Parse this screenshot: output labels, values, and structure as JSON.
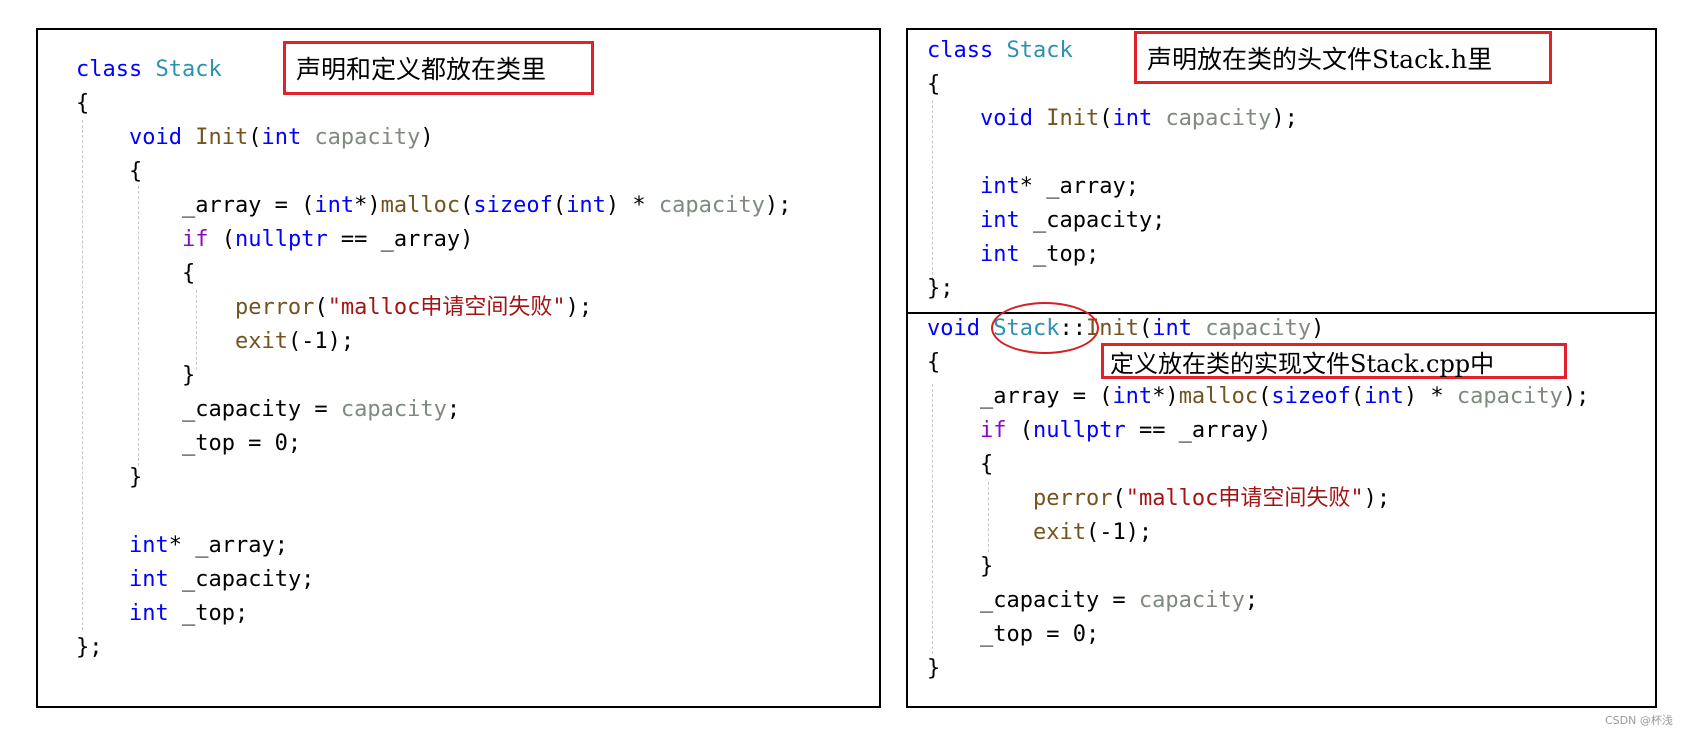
{
  "left_panel": {
    "note": "声明和定义都放在类里",
    "code": [
      [
        [
          "class ",
          "kw"
        ],
        [
          "Stack",
          "ty"
        ]
      ],
      [
        [
          "{",
          "pl"
        ]
      ],
      [
        [
          "    ",
          "pl"
        ],
        [
          "void ",
          "kw"
        ],
        [
          "Init",
          "fn"
        ],
        [
          "(",
          "pl"
        ],
        [
          "int ",
          "kw"
        ],
        [
          "capacity",
          "pm"
        ],
        [
          ")",
          "pl"
        ]
      ],
      [
        [
          "    {",
          "pl"
        ]
      ],
      [
        [
          "        _array = (",
          "pl"
        ],
        [
          "int",
          "kw"
        ],
        [
          "*)",
          "pl"
        ],
        [
          "malloc",
          "fn"
        ],
        [
          "(",
          "pl"
        ],
        [
          "sizeof",
          "kw"
        ],
        [
          "(",
          "pl"
        ],
        [
          "int",
          "kw"
        ],
        [
          ") * ",
          "pl"
        ],
        [
          "capacity",
          "pm"
        ],
        [
          ");",
          "pl"
        ]
      ],
      [
        [
          "        ",
          "pl"
        ],
        [
          "if",
          "ct"
        ],
        [
          " (",
          "pl"
        ],
        [
          "nullptr",
          "kw"
        ],
        [
          " == _array)",
          "pl"
        ]
      ],
      [
        [
          "        {",
          "pl"
        ]
      ],
      [
        [
          "            ",
          "pl"
        ],
        [
          "perror",
          "fn"
        ],
        [
          "(",
          "pl"
        ],
        [
          "\"malloc申请空间失败\"",
          "st"
        ],
        [
          ");",
          "pl"
        ]
      ],
      [
        [
          "            ",
          "pl"
        ],
        [
          "exit",
          "fn"
        ],
        [
          "(-1);",
          "pl"
        ]
      ],
      [
        [
          "        }",
          "pl"
        ]
      ],
      [
        [
          "        _capacity = ",
          "pl"
        ],
        [
          "capacity",
          "pm"
        ],
        [
          ";",
          "pl"
        ]
      ],
      [
        [
          "        _top = 0;",
          "pl"
        ]
      ],
      [
        [
          "    }",
          "pl"
        ]
      ],
      [
        [
          "",
          "pl"
        ]
      ],
      [
        [
          "    ",
          "pl"
        ],
        [
          "int",
          "kw"
        ],
        [
          "* _array;",
          "pl"
        ]
      ],
      [
        [
          "    ",
          "pl"
        ],
        [
          "int",
          "kw"
        ],
        [
          " _capacity;",
          "pl"
        ]
      ],
      [
        [
          "    ",
          "pl"
        ],
        [
          "int",
          "kw"
        ],
        [
          " _top;",
          "pl"
        ]
      ],
      [
        [
          "};",
          "pl"
        ]
      ]
    ]
  },
  "right_top_panel": {
    "note": "声明放在类的头文件Stack.h里",
    "code": [
      [
        [
          "class ",
          "kw"
        ],
        [
          "Stack",
          "ty"
        ]
      ],
      [
        [
          "{",
          "pl"
        ]
      ],
      [
        [
          "    ",
          "pl"
        ],
        [
          "void ",
          "kw"
        ],
        [
          "Init",
          "fn"
        ],
        [
          "(",
          "pl"
        ],
        [
          "int ",
          "kw"
        ],
        [
          "capacity",
          "pm"
        ],
        [
          ");",
          "pl"
        ]
      ],
      [
        [
          "",
          "pl"
        ]
      ],
      [
        [
          "    ",
          "pl"
        ],
        [
          "int",
          "kw"
        ],
        [
          "* _array;",
          "pl"
        ]
      ],
      [
        [
          "    ",
          "pl"
        ],
        [
          "int",
          "kw"
        ],
        [
          " _capacity;",
          "pl"
        ]
      ],
      [
        [
          "    ",
          "pl"
        ],
        [
          "int",
          "kw"
        ],
        [
          " _top;",
          "pl"
        ]
      ],
      [
        [
          "};",
          "pl"
        ]
      ]
    ]
  },
  "right_bottom_panel": {
    "note": "定义放在类的实现文件Stack.cpp中",
    "code": [
      [
        [
          "void ",
          "kw"
        ],
        [
          "Stack",
          "ty"
        ],
        [
          "::",
          "pl"
        ],
        [
          "Init",
          "fn"
        ],
        [
          "(",
          "pl"
        ],
        [
          "int ",
          "kw"
        ],
        [
          "capacity",
          "pm"
        ],
        [
          ")",
          "pl"
        ]
      ],
      [
        [
          "{",
          "pl"
        ]
      ],
      [
        [
          "    _array = (",
          "pl"
        ],
        [
          "int",
          "kw"
        ],
        [
          "*)",
          "pl"
        ],
        [
          "malloc",
          "fn"
        ],
        [
          "(",
          "pl"
        ],
        [
          "sizeof",
          "kw"
        ],
        [
          "(",
          "pl"
        ],
        [
          "int",
          "kw"
        ],
        [
          ") * ",
          "pl"
        ],
        [
          "capacity",
          "pm"
        ],
        [
          ");",
          "pl"
        ]
      ],
      [
        [
          "    ",
          "pl"
        ],
        [
          "if",
          "ct"
        ],
        [
          " (",
          "pl"
        ],
        [
          "nullptr",
          "kw"
        ],
        [
          " == _array)",
          "pl"
        ]
      ],
      [
        [
          "    {",
          "pl"
        ]
      ],
      [
        [
          "        ",
          "pl"
        ],
        [
          "perror",
          "fn"
        ],
        [
          "(",
          "pl"
        ],
        [
          "\"malloc申请空间失败\"",
          "st"
        ],
        [
          ");",
          "pl"
        ]
      ],
      [
        [
          "        ",
          "pl"
        ],
        [
          "exit",
          "fn"
        ],
        [
          "(-1);",
          "pl"
        ]
      ],
      [
        [
          "    }",
          "pl"
        ]
      ],
      [
        [
          "    _capacity = ",
          "pl"
        ],
        [
          "capacity",
          "pm"
        ],
        [
          ";",
          "pl"
        ]
      ],
      [
        [
          "    _top = 0;",
          "pl"
        ]
      ],
      [
        [
          "}",
          "pl"
        ]
      ]
    ]
  },
  "colors": {
    "keyword": "#0000ff",
    "type": "#2b91af",
    "function": "#74531f",
    "parameter": "#7f8a7f",
    "string": "#a31515",
    "control": "#8f08c4",
    "annotation_border": "#e3212b"
  },
  "watermark": "CSDN @杯浅"
}
